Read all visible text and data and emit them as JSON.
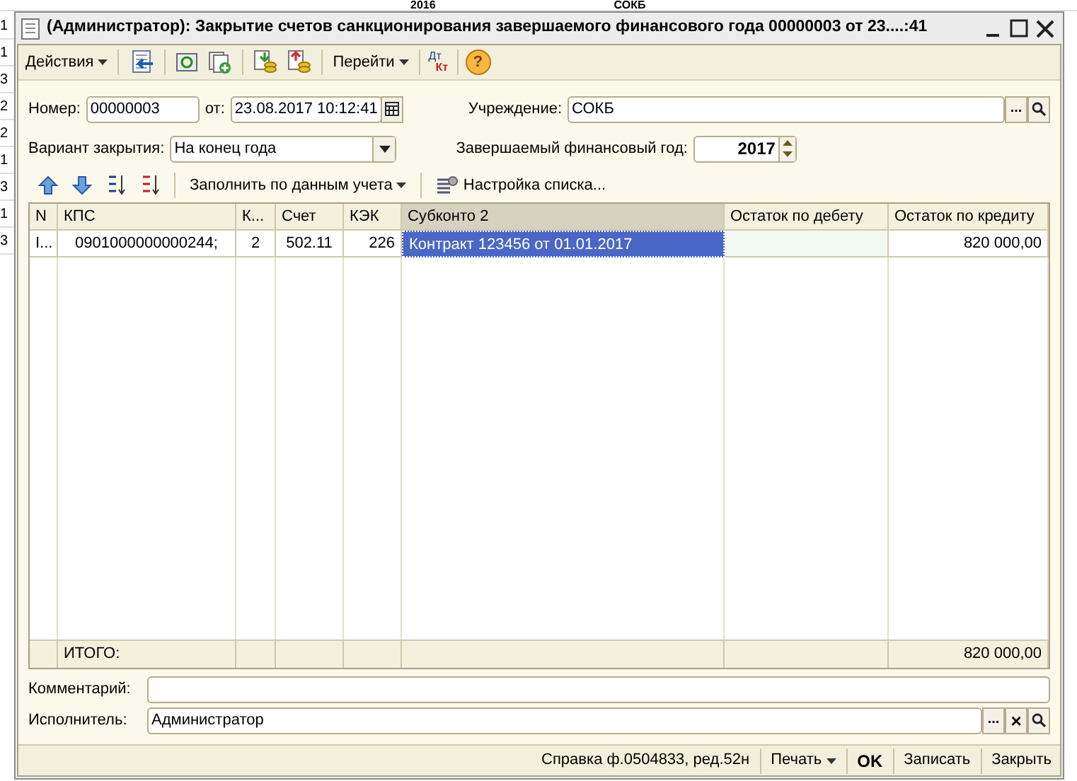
{
  "background_sheet": {
    "top_cells": [
      "2016",
      "СОКБ"
    ],
    "row_digits": [
      "1",
      "1",
      "3",
      "2",
      "2",
      "1",
      "3",
      "1",
      "3"
    ]
  },
  "window": {
    "title": "(Администратор): Закрытие счетов санкционирования завершаемого финансового года 00000003 от 23....:41"
  },
  "toolbar": {
    "actions_menu": "Действия",
    "goto_menu": "Перейти",
    "dt_kt": [
      "Дт",
      "Кт"
    ],
    "help": "?"
  },
  "form": {
    "number_label": "Номер:",
    "number": "00000003",
    "date_label": "от:",
    "date": "23.08.2017 10:12:41",
    "institution_label": "Учреждение:",
    "institution": "СОКБ",
    "choice_button": "...",
    "variant_label": "Вариант закрытия:",
    "variant": "На конец года",
    "year_label": "Завершаемый финансовый год:",
    "year": "2017"
  },
  "table_toolbar": {
    "fill_menu": "Заполнить по данным учета",
    "list_settings": "Настройка списка..."
  },
  "table": {
    "columns": [
      {
        "label": "N",
        "selected": false
      },
      {
        "label": "КПС",
        "selected": false
      },
      {
        "label": "К...",
        "selected": false
      },
      {
        "label": "Счет",
        "selected": false
      },
      {
        "label": "КЭК",
        "selected": false
      },
      {
        "label": "Субконто 2",
        "selected": true
      },
      {
        "label": "Остаток по дебету",
        "selected": false
      },
      {
        "label": "Остаток по кредиту",
        "selected": false
      }
    ],
    "rows": [
      {
        "cells": [
          {
            "text": "I...",
            "selected": false
          },
          {
            "text": "0901000000000244;",
            "selected": false
          },
          {
            "text": "2",
            "selected": false
          },
          {
            "text": "502.11",
            "selected": false
          },
          {
            "text": "226",
            "selected": false
          },
          {
            "text": "Контракт 123456 от 01.01.2017",
            "selected": true
          },
          {
            "selected": false
          },
          {
            "text": "820 000,00",
            "selected": false
          }
        ]
      }
    ],
    "footer": {
      "label": "ИТОГО:",
      "credit_total": "820 000,00"
    }
  },
  "comment": {
    "label": "Комментарий:"
  },
  "executor": {
    "label": "Исполнитель:",
    "value": "Администратор",
    "choice_button": "...",
    "clear_button": "×"
  },
  "bottom_bar": {
    "report": "Справка ф.0504833, ред.52н",
    "print_menu": "Печать",
    "ok": "OK",
    "save": "Записать",
    "close": "Закрыть"
  }
}
